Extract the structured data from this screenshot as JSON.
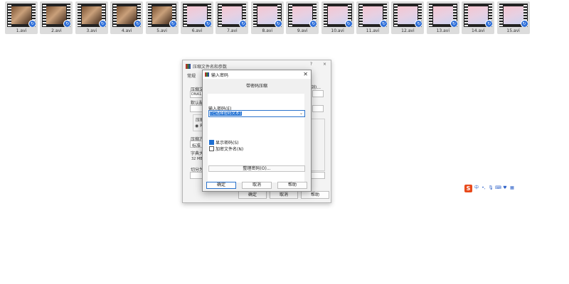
{
  "files": [
    {
      "name": "1.avi",
      "kind": "video"
    },
    {
      "name": "2.avi",
      "kind": "video"
    },
    {
      "name": "3.avi",
      "kind": "video"
    },
    {
      "name": "4.avi",
      "kind": "video"
    },
    {
      "name": "5.avi",
      "kind": "video"
    },
    {
      "name": "6.avi",
      "kind": "pink"
    },
    {
      "name": "7.avi",
      "kind": "pink"
    },
    {
      "name": "8.avi",
      "kind": "pink"
    },
    {
      "name": "9.avi",
      "kind": "pink"
    },
    {
      "name": "10.avi",
      "kind": "pink"
    },
    {
      "name": "11.avi",
      "kind": "pink"
    },
    {
      "name": "12.avi",
      "kind": "pink"
    },
    {
      "name": "13.avi",
      "kind": "pink"
    },
    {
      "name": "14.avi",
      "kind": "pink"
    },
    {
      "name": "15.avi",
      "kind": "pink"
    }
  ],
  "rar_dialog": {
    "title": "压缩文件名和参数",
    "help": "?",
    "close": "×",
    "tab_general": "常规",
    "frag_archive_label": "压缩文",
    "frag_archive_value": "DNA1.r",
    "frag_browse": "浏)...",
    "frag_default_profile": "默认配",
    "frag_format": "压缩",
    "frag_format_rar": "RA",
    "frag_method_label": "压缩方",
    "frag_method_value": "标准",
    "frag_dict_label": "字典大",
    "frag_dict_value": "32 MB",
    "frag_split_label": "切分为",
    "ok": "确定",
    "cancel": "取消",
    "help_btn": "帮助"
  },
  "password_dialog": {
    "title": "输入密码",
    "close": "✕",
    "heading": "带密码压缩",
    "password_label": "输入密码(E)",
    "password_value": "[已选择密码文本]",
    "show_password": "显示密码(S)",
    "encrypt_names": "加密文件名(N)",
    "organize": "整理密码(O)...",
    "ok": "确定",
    "cancel": "取消",
    "help": "帮助"
  },
  "ime": {
    "logo": "S",
    "mode": "中"
  },
  "colors": {
    "accent": "#1e6fd2",
    "sogou": "#e84a1b",
    "thumb_bg": "#dcdcdc"
  }
}
